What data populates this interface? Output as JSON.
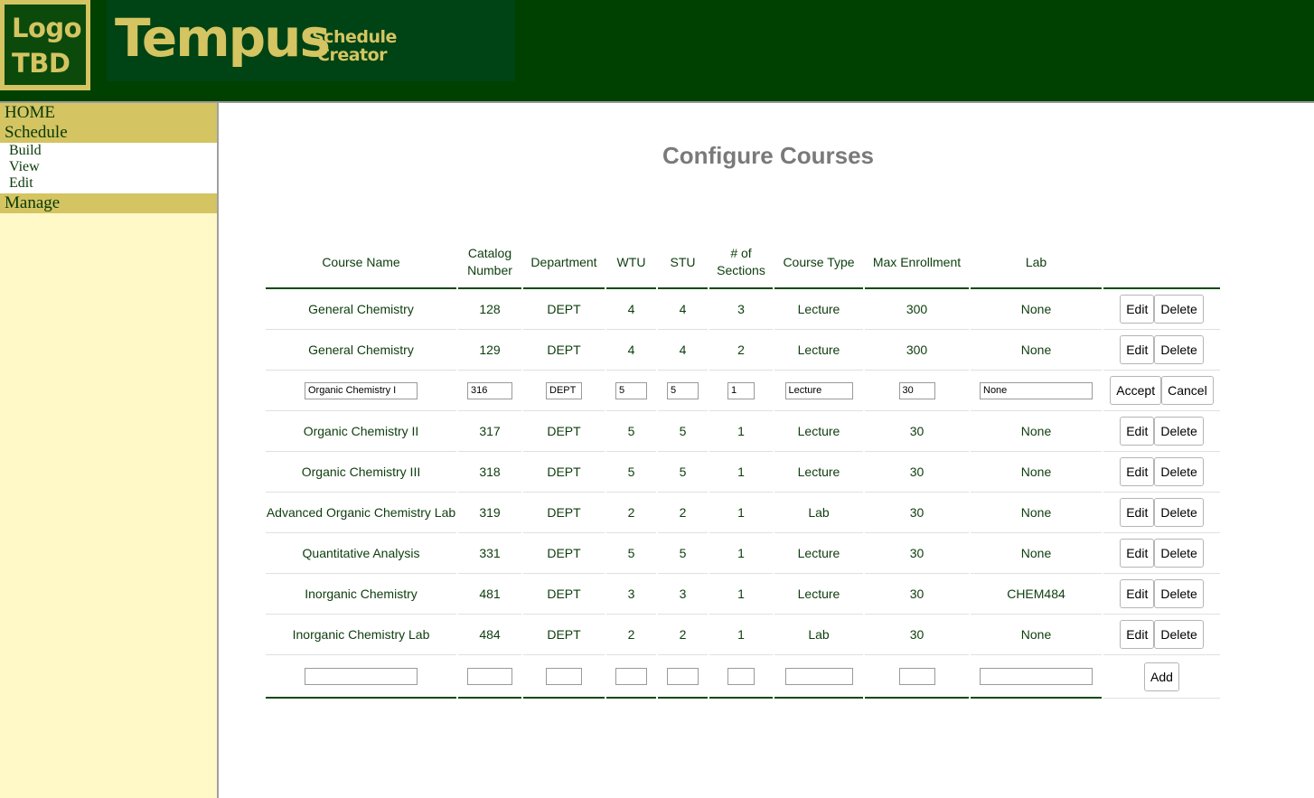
{
  "logo": {
    "line1": "Logo",
    "line2": "TBD"
  },
  "app": {
    "title": "Tempus",
    "subtitle1": "Schedule",
    "subtitle2": "Creator"
  },
  "nav": {
    "home": "HOME",
    "schedule": "Schedule",
    "schedule_items": [
      "Build",
      "View",
      "Edit"
    ],
    "manage": "Manage"
  },
  "page": {
    "title": "Configure Courses"
  },
  "table": {
    "headers": {
      "course_name": "Course Name",
      "catalog_number_1": "Catalog",
      "catalog_number_2": "Number",
      "department": "Department",
      "wtu": "WTU",
      "stu": "STU",
      "sections_1": "# of",
      "sections_2": "Sections",
      "course_type": "Course Type",
      "max_enrollment": "Max Enrollment",
      "lab": "Lab"
    },
    "rows": [
      {
        "name": "General Chemistry",
        "catalog": "128",
        "dept": "DEPT",
        "wtu": "4",
        "stu": "4",
        "sections": "3",
        "type": "Lecture",
        "max": "300",
        "lab": "None"
      },
      {
        "name": "General Chemistry",
        "catalog": "129",
        "dept": "DEPT",
        "wtu": "4",
        "stu": "4",
        "sections": "2",
        "type": "Lecture",
        "max": "300",
        "lab": "None"
      },
      {
        "name": "Organic Chemistry I",
        "catalog": "316",
        "dept": "DEPT",
        "wtu": "5",
        "stu": "5",
        "sections": "1",
        "type": "Lecture",
        "max": "30",
        "lab": "None"
      },
      {
        "name": "Organic Chemistry II",
        "catalog": "317",
        "dept": "DEPT",
        "wtu": "5",
        "stu": "5",
        "sections": "1",
        "type": "Lecture",
        "max": "30",
        "lab": "None"
      },
      {
        "name": "Organic Chemistry III",
        "catalog": "318",
        "dept": "DEPT",
        "wtu": "5",
        "stu": "5",
        "sections": "1",
        "type": "Lecture",
        "max": "30",
        "lab": "None"
      },
      {
        "name": "Advanced Organic Chemistry Lab",
        "catalog": "319",
        "dept": "DEPT",
        "wtu": "2",
        "stu": "2",
        "sections": "1",
        "type": "Lab",
        "max": "30",
        "lab": "None"
      },
      {
        "name": "Quantitative Analysis",
        "catalog": "331",
        "dept": "DEPT",
        "wtu": "5",
        "stu": "5",
        "sections": "1",
        "type": "Lecture",
        "max": "30",
        "lab": "None"
      },
      {
        "name": "Inorganic Chemistry",
        "catalog": "481",
        "dept": "DEPT",
        "wtu": "3",
        "stu": "3",
        "sections": "1",
        "type": "Lecture",
        "max": "30",
        "lab": "CHEM484"
      },
      {
        "name": "Inorganic Chemistry Lab",
        "catalog": "484",
        "dept": "DEPT",
        "wtu": "2",
        "stu": "2",
        "sections": "1",
        "type": "Lab",
        "max": "30",
        "lab": "None"
      }
    ],
    "editing_row_index": 2,
    "buttons": {
      "edit": "Edit",
      "delete": "Delete",
      "accept": "Accept",
      "cancel": "Cancel",
      "add": "Add"
    }
  },
  "colors": {
    "header_bg": "#004000",
    "accent_gold": "#d4c462",
    "sidebar_bg": "#fff9c8",
    "text_green": "#0d3d0d"
  }
}
